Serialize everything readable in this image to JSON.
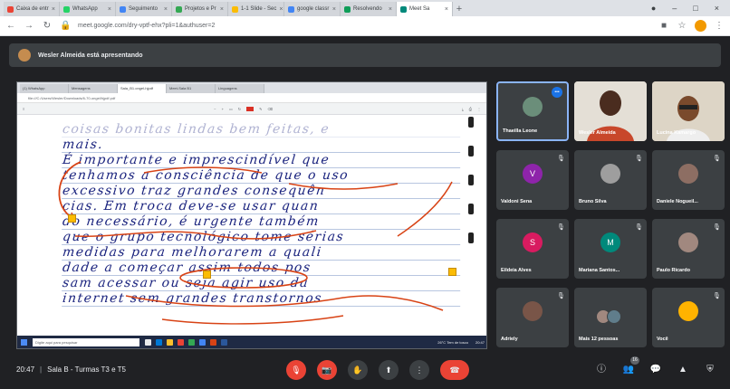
{
  "browser": {
    "tabs": [
      {
        "label": "Caixa de entr"
      },
      {
        "label": "WhatsApp"
      },
      {
        "label": "Seguimento"
      },
      {
        "label": "Projetos e Pr"
      },
      {
        "label": "1-1 Slide - Sec"
      },
      {
        "label": "google classr"
      },
      {
        "label": "Resolvendo"
      },
      {
        "label": "Meet Sa",
        "active": true
      }
    ],
    "url": "meet.google.com/dry-vptf-ehx?pli=1&authuser=2"
  },
  "presenter": {
    "text": "Wesler Almeida está apresentando"
  },
  "shared_screen": {
    "inner_tabs": [
      "(1) WhatsApp",
      "Mensagens",
      "Sala_B1.ongel-hjpdf",
      "Meet-Sala B1",
      "Linguagens"
    ],
    "inner_url": "file:///C:/Users/Wesler/Downloads/6-70-ongel/hjpdf.pdf",
    "handwriting_lines": [
      "coisas bonitas lindas bem feitas, e",
      "mais.",
      "É importante e imprescindível que",
      "tenhamos a consciência de que o uso",
      "excessivo traz grandes consequên",
      "cias. Em troca deve-se usar quan",
      "do necessário, é urgente também",
      "que o grupo tecnológico tome sérias",
      "medidas para melhorarem a quali",
      "dade a começar assim todos pos",
      "sam acessar ou seja agir uso da",
      "internet sem grandes transtornos"
    ],
    "taskbar_search": "Digite aqui para pesquisar",
    "taskbar_tray": "26°C Tem de tosco",
    "taskbar_clock": "20:47"
  },
  "participants": [
    {
      "name": "Thaeilla Leone",
      "initial": "",
      "color": "#6b8e7a",
      "speaking": true
    },
    {
      "name": "Wesler Almeida",
      "initial": "",
      "color": "#5b3a2a",
      "photo": true
    },
    {
      "name": "Lucina Kamargo",
      "initial": "",
      "color": "#7a4a2c",
      "photo": true
    },
    {
      "name": "Valdoni Sena",
      "initial": "V",
      "color": "#8e24aa"
    },
    {
      "name": "Bruno Silva",
      "initial": "",
      "color": "#9e9e9e"
    },
    {
      "name": "Daniele Nogueil...",
      "initial": "",
      "color": "#8d6e63"
    },
    {
      "name": "Eildeia Alves",
      "initial": "S",
      "color": "#d81b60"
    },
    {
      "name": "Mariana Santos...",
      "initial": "M",
      "color": "#00897b"
    },
    {
      "name": "Paulo Ricardo",
      "initial": "",
      "color": "#a1887f"
    },
    {
      "name": "Adriely",
      "initial": "",
      "color": "#795548"
    },
    {
      "name": "Mais 12 pessoas",
      "initial": "",
      "color": "#5f6368",
      "more": true
    },
    {
      "name": "Você",
      "initial": "",
      "color": "#ffb300"
    }
  ],
  "bottom_bar": {
    "time": "20:47",
    "meeting_name": "Sala B - Turmas T3 e T5",
    "participant_count": "16"
  }
}
